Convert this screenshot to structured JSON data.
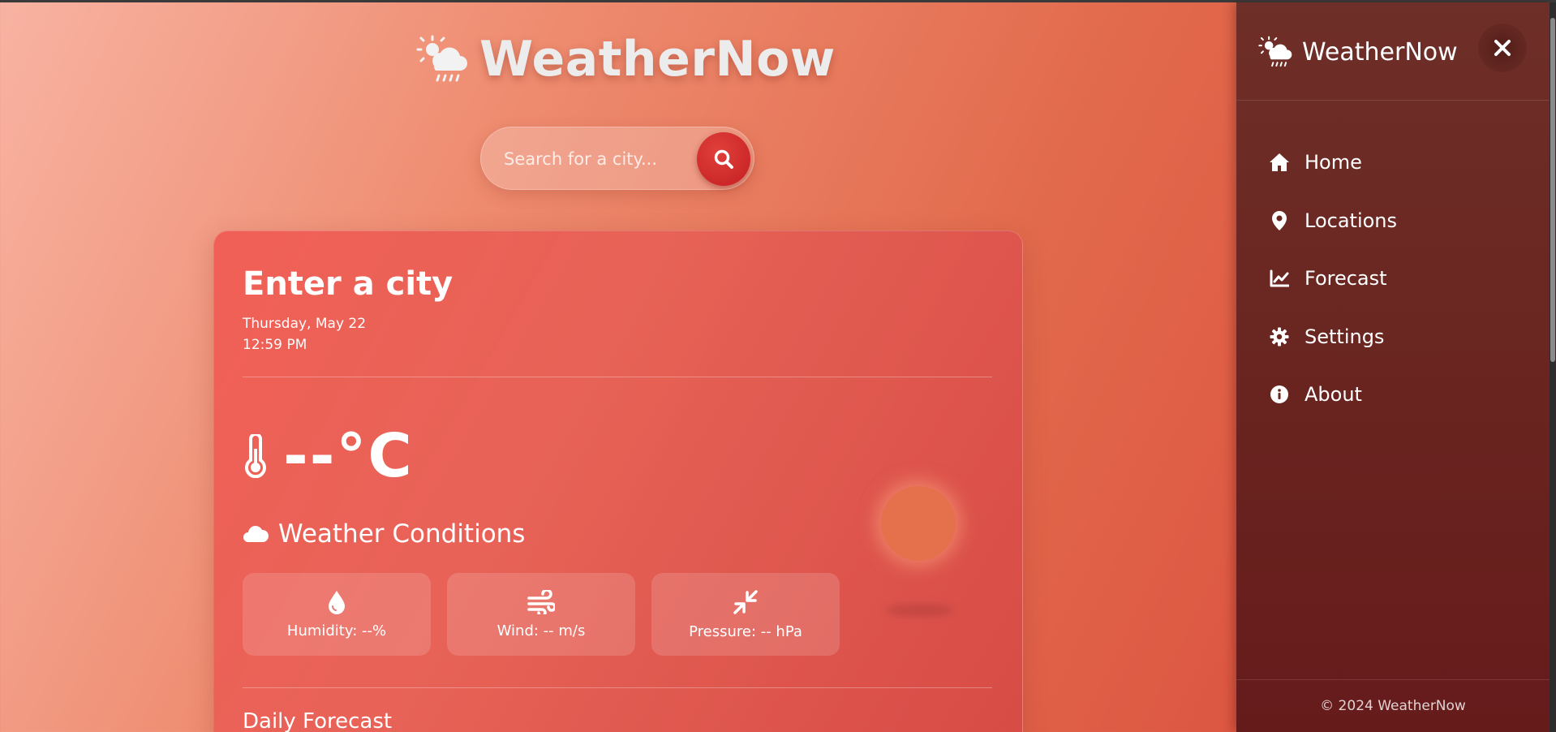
{
  "app": {
    "title": "WeatherNow"
  },
  "search": {
    "placeholder": "Search for a city..."
  },
  "card": {
    "city": "Enter a city",
    "date": "Thursday, May 22",
    "time": "12:59 PM",
    "temperature": "--°C",
    "conditions_label": "Weather Conditions",
    "stats": [
      {
        "icon": "droplet-icon",
        "label": "Humidity: --%"
      },
      {
        "icon": "wind-icon",
        "label": "Wind: -- m/s"
      },
      {
        "icon": "compress-icon",
        "label": "Pressure: -- hPa"
      }
    ],
    "daily_forecast_title": "Daily Forecast"
  },
  "sidebar": {
    "title": "WeatherNow",
    "items": [
      {
        "icon": "home-icon",
        "label": "Home"
      },
      {
        "icon": "location-pin-icon",
        "label": "Locations"
      },
      {
        "icon": "chart-line-icon",
        "label": "Forecast"
      },
      {
        "icon": "gear-icon",
        "label": "Settings"
      },
      {
        "icon": "info-icon",
        "label": "About"
      }
    ],
    "footer": "© 2024 WeatherNow"
  },
  "colors": {
    "accent_red": "#c41e22",
    "sidebar_bg": "#6a2520",
    "sun": "#e5704c"
  }
}
